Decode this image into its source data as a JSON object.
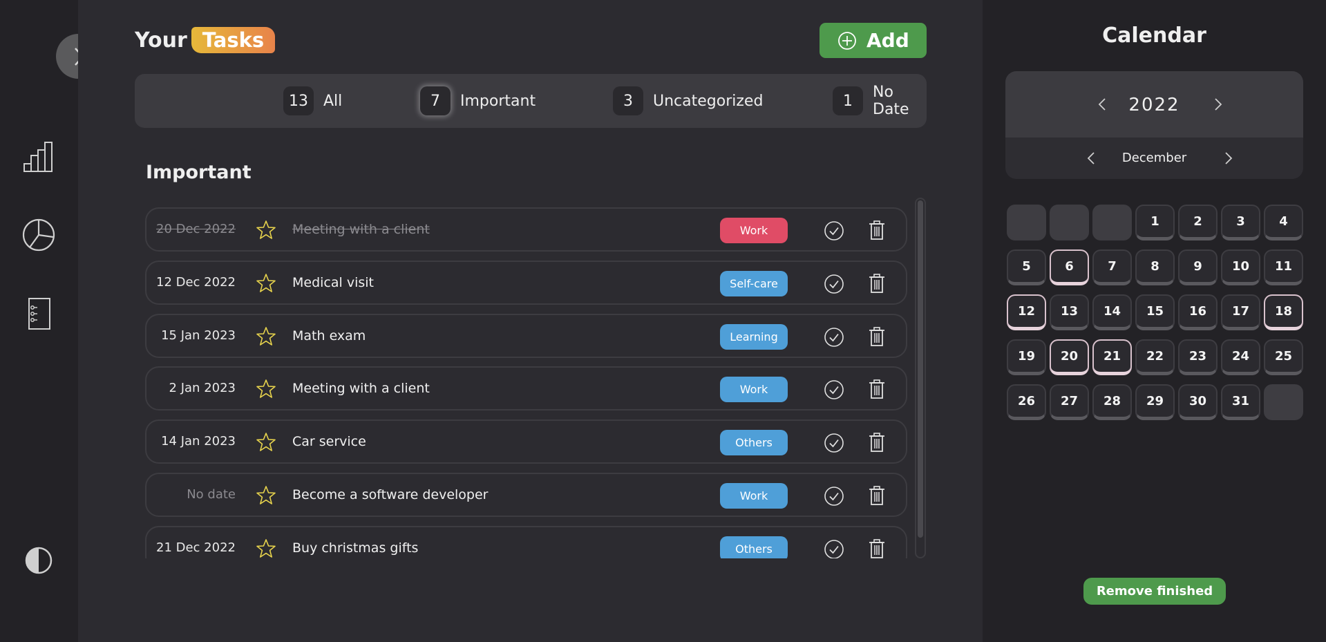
{
  "header": {
    "title_prefix": "Your",
    "title_highlight": "Tasks",
    "add_label": "Add"
  },
  "sidebar": {
    "icons": [
      "chevron-right-icon",
      "bar-chart-icon",
      "pie-chart-icon",
      "notebook-icon",
      "contrast-icon"
    ]
  },
  "filters": [
    {
      "count": "13",
      "label": "All",
      "active": false
    },
    {
      "count": "7",
      "label": "Important",
      "active": true
    },
    {
      "count": "3",
      "label": "Uncategorized",
      "active": false
    },
    {
      "count": "1",
      "label": "No Date",
      "active": false
    }
  ],
  "section_title": "Important",
  "tasks": [
    {
      "date": "20 Dec 2022",
      "title": "Meeting with a client",
      "tag": "Work",
      "tag_color": "#e04c66",
      "done": true,
      "muted_date": false
    },
    {
      "date": "12 Dec 2022",
      "title": "Medical visit",
      "tag": "Self-care",
      "tag_color": "#4f9fd8",
      "done": false,
      "muted_date": false
    },
    {
      "date": "15 Jan 2023",
      "title": "Math exam",
      "tag": "Learning",
      "tag_color": "#4f9fd8",
      "done": false,
      "muted_date": false
    },
    {
      "date": "2 Jan 2023",
      "title": "Meeting with a client",
      "tag": "Work",
      "tag_color": "#4f9fd8",
      "done": false,
      "muted_date": false
    },
    {
      "date": "14 Jan 2023",
      "title": "Car service",
      "tag": "Others",
      "tag_color": "#4f9fd8",
      "done": false,
      "muted_date": false
    },
    {
      "date": "No date",
      "title": "Become a software developer",
      "tag": "Work",
      "tag_color": "#4f9fd8",
      "done": false,
      "muted_date": true
    },
    {
      "date": "21 Dec 2022",
      "title": "Buy christmas gifts",
      "tag": "Others",
      "tag_color": "#4f9fd8",
      "done": false,
      "muted_date": false
    }
  ],
  "calendar": {
    "title": "Calendar",
    "year": "2022",
    "month": "December",
    "leading_blanks": 3,
    "trailing_blanks": 1,
    "days_in_month": 31,
    "marked_days": [
      6,
      12,
      18,
      20,
      21
    ]
  },
  "remove_label": "Remove finished",
  "colors": {
    "accent_green": "#4e9a4c",
    "star": "#e8d44d",
    "tag_red": "#e04c66",
    "tag_blue": "#4f9fd8"
  }
}
